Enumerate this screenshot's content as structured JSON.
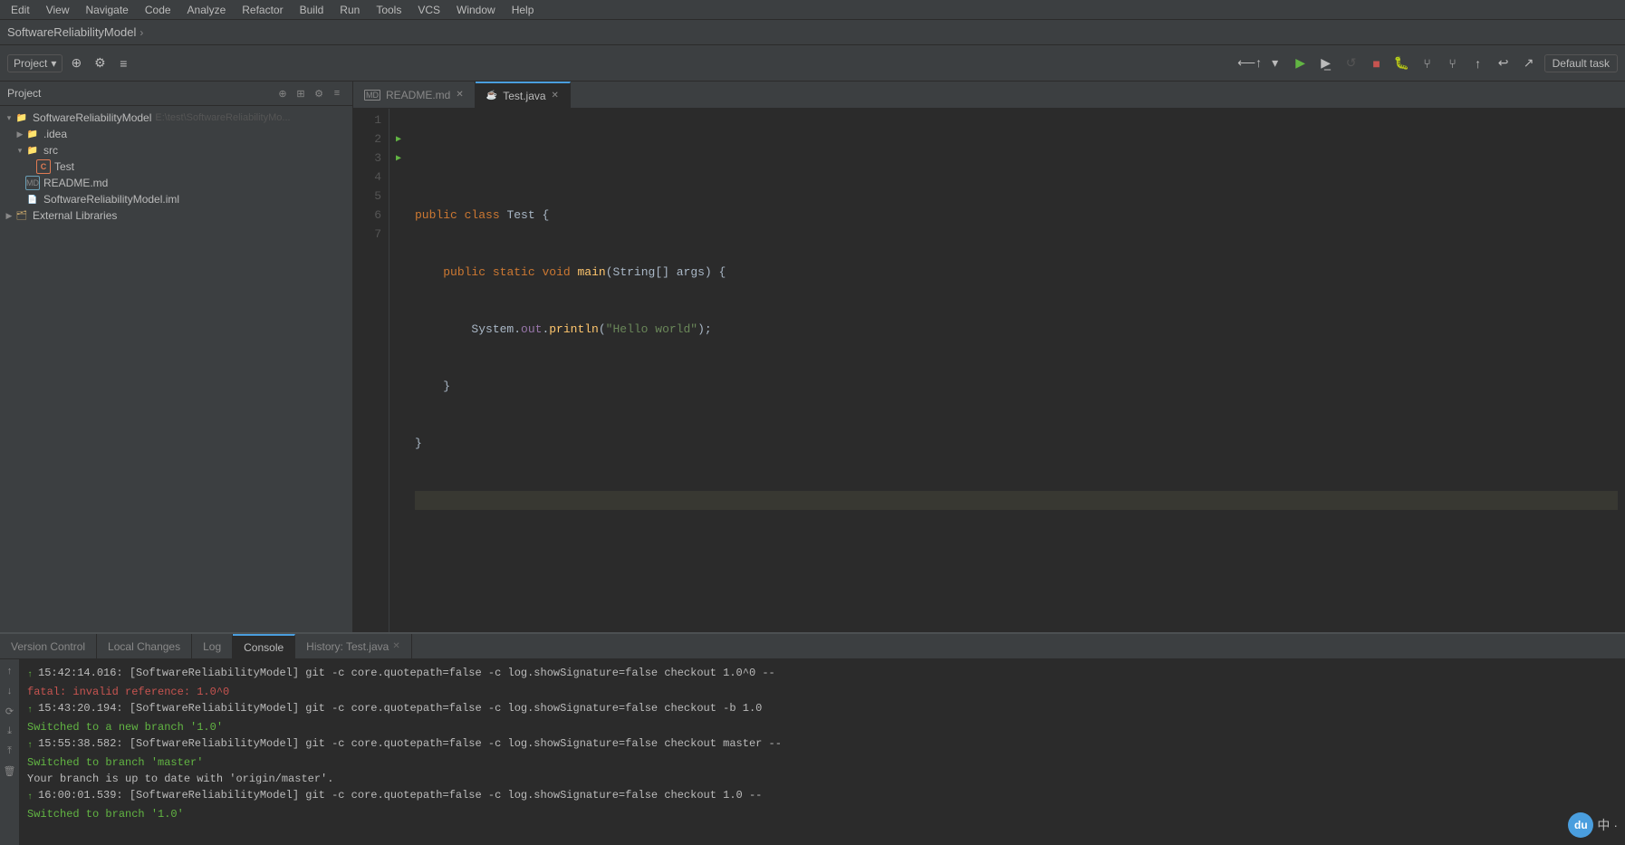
{
  "menubar": {
    "items": [
      "Edit",
      "View",
      "Navigate",
      "Code",
      "Analyze",
      "Refactor",
      "Build",
      "Run",
      "Tools",
      "VCS",
      "Window",
      "Help"
    ]
  },
  "titlebar": {
    "project": "SoftwareReliabilityModel",
    "arrow": "›"
  },
  "toolbar": {
    "project_label": "Project",
    "default_task": "Default task"
  },
  "sidebar": {
    "root_name": "SoftwareReliabilityModel",
    "root_path": "E:\\test\\SoftwareReliabilityMo...",
    "items": [
      {
        "label": ".idea",
        "type": "folder",
        "indent": 1,
        "expanded": false
      },
      {
        "label": "src",
        "type": "folder",
        "indent": 1,
        "expanded": true
      },
      {
        "label": "Test",
        "type": "java",
        "indent": 2,
        "expanded": false
      },
      {
        "label": "README.md",
        "type": "md",
        "indent": 1,
        "expanded": false
      },
      {
        "label": "SoftwareReliabilityModel.iml",
        "type": "iml",
        "indent": 1,
        "expanded": false
      },
      {
        "label": "External Libraries",
        "type": "lib",
        "indent": 0,
        "expanded": false
      }
    ]
  },
  "tabs": [
    {
      "label": "README.md",
      "type": "md",
      "active": false,
      "closeable": true
    },
    {
      "label": "Test.java",
      "type": "java",
      "active": true,
      "closeable": true
    }
  ],
  "code": {
    "lines": [
      {
        "num": 1,
        "content": "",
        "has_run": false,
        "highlighted": false
      },
      {
        "num": 2,
        "content": "public class Test {",
        "has_run": true,
        "highlighted": false
      },
      {
        "num": 3,
        "content": "    public static void main(String[] args) {",
        "has_run": true,
        "highlighted": false
      },
      {
        "num": 4,
        "content": "        System.out.println(\"Hello world\");",
        "has_run": false,
        "highlighted": false
      },
      {
        "num": 5,
        "content": "    }",
        "has_run": false,
        "highlighted": false
      },
      {
        "num": 6,
        "content": "}",
        "has_run": false,
        "highlighted": false
      },
      {
        "num": 7,
        "content": "",
        "has_run": false,
        "highlighted": true
      }
    ]
  },
  "bottom_panel": {
    "tabs": [
      {
        "label": "Version Control",
        "active": false
      },
      {
        "label": "Local Changes",
        "active": false
      },
      {
        "label": "Log",
        "active": false
      },
      {
        "label": "Console",
        "active": true
      },
      {
        "label": "History: Test.java",
        "active": false,
        "closeable": true
      }
    ],
    "console_lines": [
      {
        "type": "up",
        "text": "15:42:14.016: [SoftwareReliabilityModel] git -c core.quotepath=false -c log.showSignature=false checkout 1.0^0 --"
      },
      {
        "type": "error",
        "text": "fatal: invalid reference: 1.0^0"
      },
      {
        "type": "up",
        "text": "15:43:20.194: [SoftwareReliabilityModel] git -c core.quotepath=false -c log.showSignature=false checkout -b 1.0"
      },
      {
        "type": "success",
        "text": "Switched to a new branch '1.0'"
      },
      {
        "type": "up",
        "text": "15:55:38.582: [SoftwareReliabilityModel] git -c core.quotepath=false -c log.showSignature=false checkout master --"
      },
      {
        "type": "success",
        "text": "Switched to branch 'master'"
      },
      {
        "type": "info",
        "text": "Your branch is up to date with 'origin/master'."
      },
      {
        "type": "up",
        "text": "16:00:01.539: [SoftwareReliabilityModel] git -c core.quotepath=false -c log.showSignature=false checkout 1.0 --"
      },
      {
        "type": "success",
        "text": "Switched to branch '1.0'"
      }
    ]
  },
  "status_bar": {
    "du_label": "du",
    "cn_label": "中",
    "dot_label": "·"
  }
}
